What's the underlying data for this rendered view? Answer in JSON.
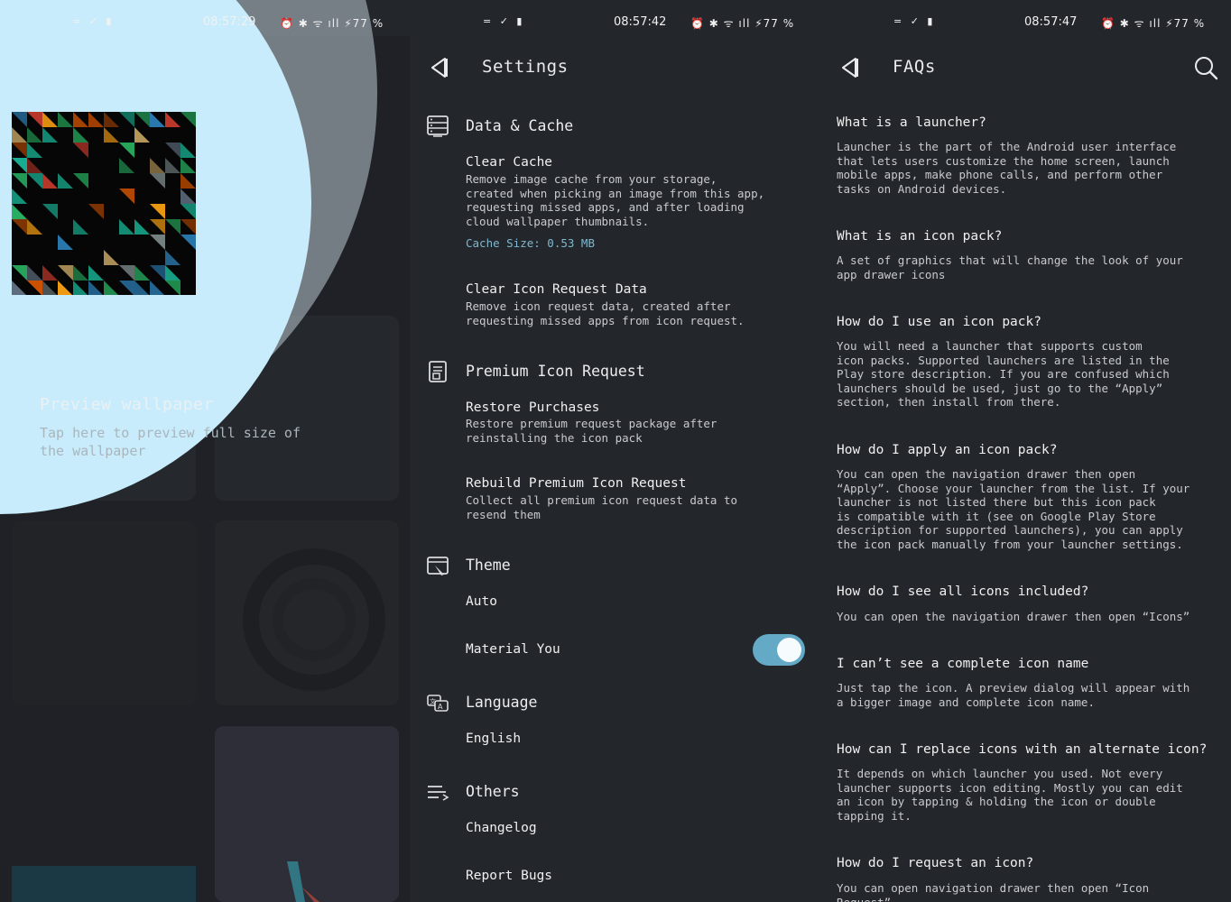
{
  "status": {
    "left_icons": "= ✓ ▮",
    "right_icons": "⏰ ✱ ᯤ ıll ⚡77 %",
    "screens": [
      {
        "time": "08:57:29"
      },
      {
        "time": "08:57:42"
      },
      {
        "time": "08:57:47"
      }
    ]
  },
  "preview": {
    "title": "Preview wallpaper",
    "subtitle": "Tap here to preview full size of the wallpaper"
  },
  "settings": {
    "title": "Settings",
    "sections": {
      "data_cache": {
        "header": "Data & Cache",
        "clear_cache": {
          "title": "Clear Cache",
          "desc": "Remove image cache from your storage,\ncreated when picking an image from this app,\nrequesting missed apps, and after loading\ncloud wallpaper thumbnails.",
          "cache_size": "Cache Size: 0.53 MB"
        },
        "clear_icon_request": {
          "title": "Clear Icon Request Data",
          "desc": "Remove icon request data, created after\nrequesting missed apps from icon request."
        }
      },
      "premium": {
        "header": "Premium Icon Request",
        "restore": {
          "title": "Restore Purchases",
          "desc": "Restore premium request package after\nreinstalling the icon pack"
        },
        "rebuild": {
          "title": "Rebuild Premium Icon Request",
          "desc": "Collect all premium icon request data to\nresend them"
        }
      },
      "theme": {
        "header": "Theme",
        "value": "Auto",
        "material_you": "Material You",
        "material_you_enabled": true
      },
      "language": {
        "header": "Language",
        "value": "English"
      },
      "others": {
        "header": "Others",
        "changelog": "Changelog",
        "report_bugs": "Report Bugs"
      }
    }
  },
  "faqs": {
    "title": "FAQs",
    "items": [
      {
        "q": "What is a launcher?",
        "a": "Launcher is the part of the Android user interface\nthat lets users customize the home screen, launch\nmobile apps, make phone calls, and perform other\ntasks on Android devices."
      },
      {
        "q": "What is an icon pack?",
        "a": "A set of graphics that will change the look of your\napp drawer icons"
      },
      {
        "q": "How do I use an icon pack?",
        "a": "You will need a launcher that supports custom\nicon packs. Supported launchers are listed in the\nPlay store description. If you are confused which\nlaunchers should be used, just go to the “Apply”\nsection, then install from there."
      },
      {
        "q": "How do I apply an icon pack?",
        "a": "You can open the navigation drawer then open\n“Apply”. Choose your launcher from the list. If your\nlauncher is not listed there but this icon pack\nis compatible with it (see on Google Play Store\ndescription for supported launchers), you can apply\nthe icon pack manually from your launcher settings."
      },
      {
        "q": "How do I see all icons included?",
        "a": "You can open the navigation drawer then open “Icons”"
      },
      {
        "q": "I can’t see a complete icon name",
        "a": "Just tap the icon. A preview dialog will appear with\na bigger image and complete icon name."
      },
      {
        "q": "How can I replace icons with an alternate icon?",
        "a": "It depends on which launcher you used. Not every\nlauncher supports icon editing. Mostly you can edit\nan icon by tapping & holding the icon or double\ntapping it."
      },
      {
        "q": "How do I request an icon?",
        "a": "You can open navigation drawer then open “Icon\nRequest”"
      }
    ]
  }
}
